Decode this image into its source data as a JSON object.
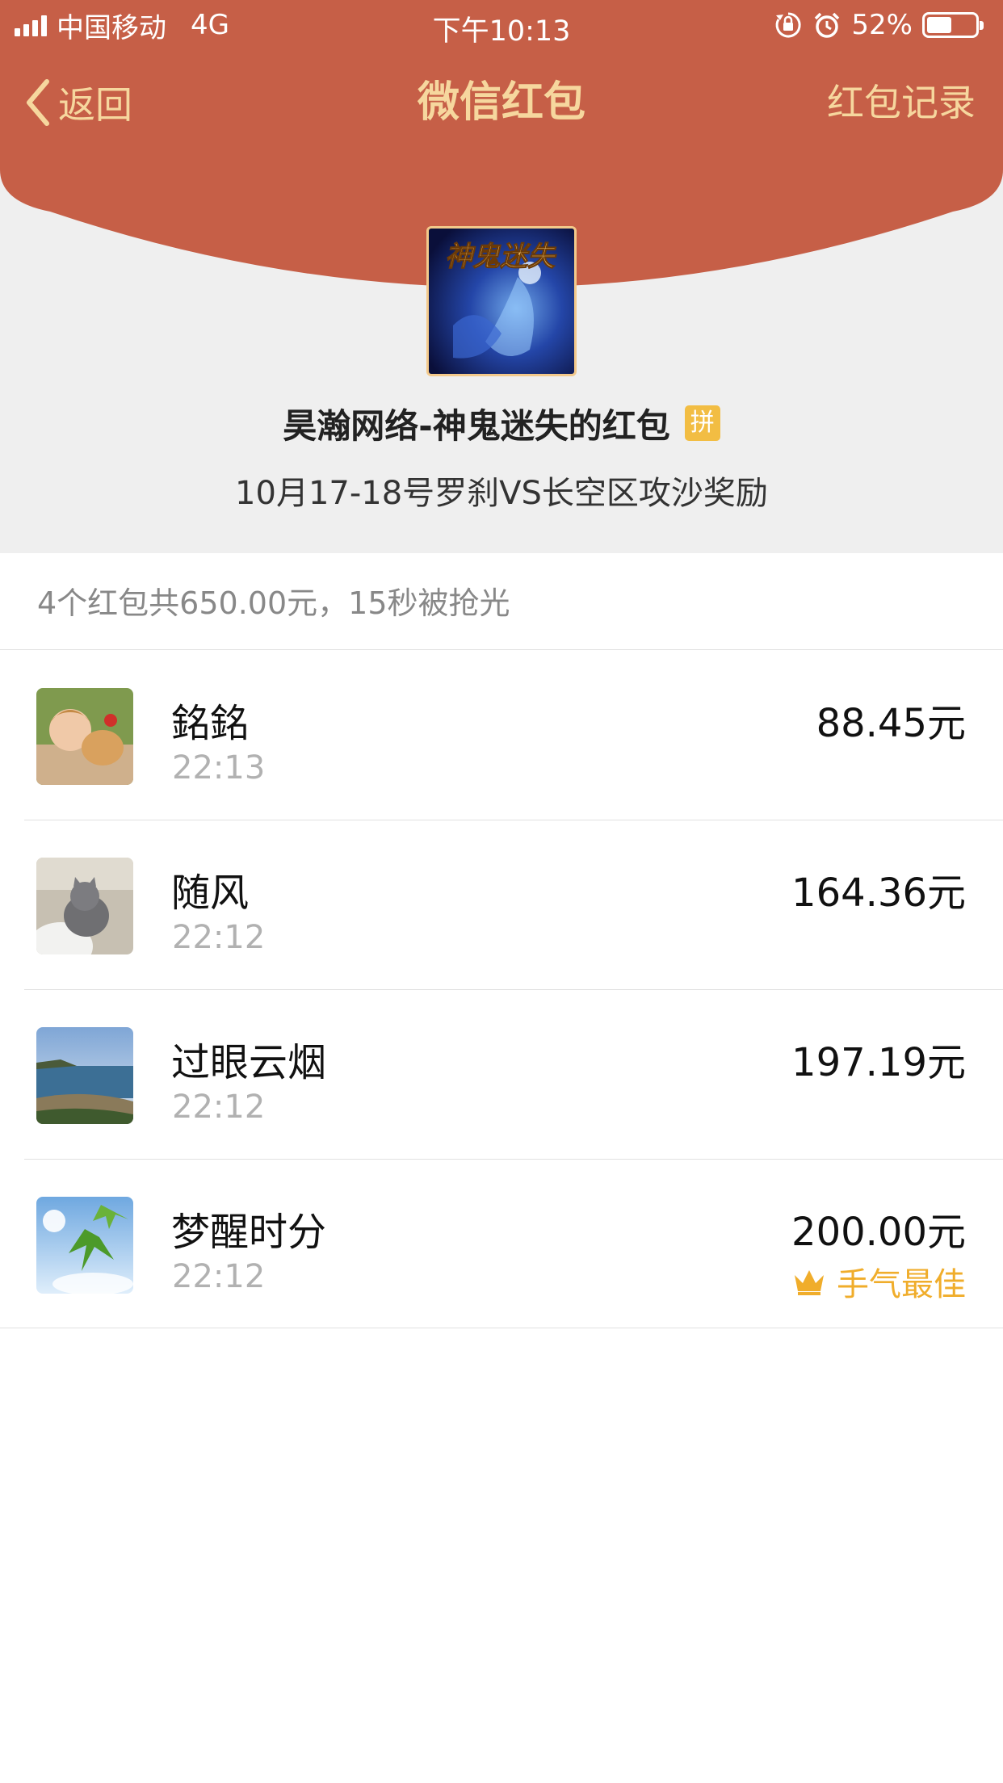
{
  "status_bar": {
    "carrier": "中国移动",
    "network": "4G",
    "time": "下午10:13",
    "battery": "52%",
    "battery_level": 0.52
  },
  "nav": {
    "back_label": "返回",
    "title": "微信红包",
    "right_label": "红包记录"
  },
  "packet": {
    "sender": "昊瀚网络-神鬼迷失的红包",
    "badge": "拼",
    "wish": "10月17-18号罗刹VS长空区攻沙奖励",
    "avatar_caption": "神鬼迷失"
  },
  "summary": "4个红包共650.00元，15秒被抢光",
  "records": [
    {
      "name": "銘銘",
      "time": "22:13",
      "amount": "88.45元"
    },
    {
      "name": "随风",
      "time": "22:12",
      "amount": "164.36元"
    },
    {
      "name": "过眼云烟",
      "time": "22:12",
      "amount": "197.19元"
    },
    {
      "name": "梦醒时分",
      "time": "22:12",
      "amount": "200.00元",
      "best_label": "手气最佳"
    }
  ],
  "colors": {
    "header_red": "#c65f47",
    "nav_gold": "#f6d79e",
    "best_gold": "#f0ad2b",
    "badge_yellow": "#f2bd43"
  },
  "icons": [
    "signal-icon",
    "orientation-lock-icon",
    "alarm-icon",
    "battery-icon",
    "back-chevron-icon",
    "crown-icon"
  ]
}
